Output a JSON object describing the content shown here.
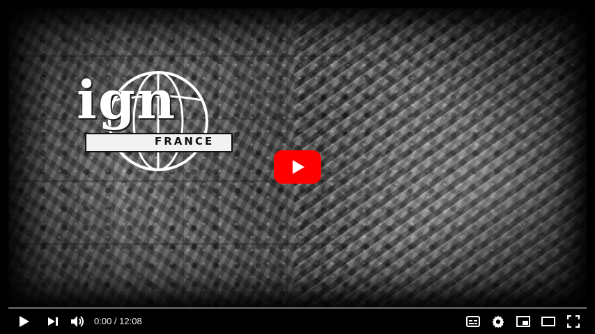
{
  "player": {
    "time_current": "0:00",
    "time_separator": " / ",
    "time_duration": "12:08",
    "progress_fraction": 0,
    "accent_color": "#ff0000"
  },
  "thumbnail": {
    "logo_main": "ign",
    "logo_sub": "FRANCE"
  },
  "controls": {
    "left": [
      "play-icon",
      "next-icon",
      "volume-icon"
    ],
    "right": [
      "subtitles-icon",
      "settings-gear-icon",
      "miniplayer-icon",
      "theater-mode-icon",
      "fullscreen-icon"
    ]
  }
}
